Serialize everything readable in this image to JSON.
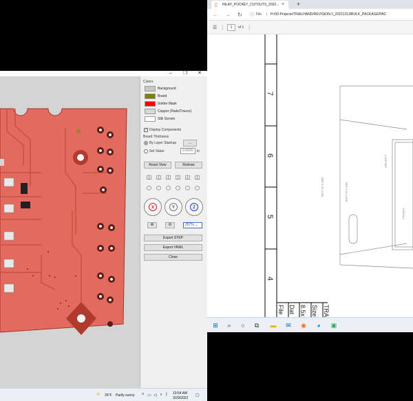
{
  "viewer": {
    "colors_title": "Colors",
    "colors": [
      {
        "label": "Background",
        "color": "#c8c8c8"
      },
      {
        "label": "Board",
        "color": "#808000"
      },
      {
        "label": "Solder Mask",
        "color": "#ff0000"
      },
      {
        "label": "Copper (Pads/Traces)",
        "color": "#d8d8d8"
      },
      {
        "label": "Silk Screen",
        "color": "#ffffff"
      }
    ],
    "display_components_label": "Display Components",
    "display_components_checked": true,
    "board_thickness_title": "Board Thickness",
    "by_layer_stackup_label": "By Layer Stackup",
    "stackup_button_label": "...",
    "set_value_label": "Set Value:",
    "set_value": "0.0626",
    "set_value_unit": "in",
    "reset_view_label": "Reset View",
    "redraw_label": "Redraw",
    "rotation_axes": [
      "X",
      "Y",
      "Z"
    ],
    "zoom_value": "257%",
    "export_step_label": "Export STEP",
    "export_vrml_label": "Export VRML",
    "close_label": "Close",
    "pcb_mask_color": "#e36a5f",
    "pcb_trace_color": "#c9513f"
  },
  "left_taskbar": {
    "weather_temp": "26°F",
    "weather_desc": "Partly sunny",
    "time": "10:54 AM",
    "date": "3/29/2022"
  },
  "browser": {
    "tab_title": "INLAY_POCKET_CUTOUTS_2022...",
    "tab_close": "×",
    "new_tab": "+",
    "address_label": "File",
    "address": "H:/00-Projects/TRAILHAND/REVISION-1_20211213/BULK_PACKAGE/PAC",
    "page_current": "1",
    "page_total": "of 1",
    "ruler_numbers": [
      "7",
      "6",
      "5",
      "4"
    ],
    "title_block_cells": [
      "File",
      "Dat",
      "8.5x",
      "Size",
      "TRA"
    ],
    "dimension_texts": [
      "REF 0.75 ±.005",
      "±.005 REF",
      "REF 0.52 ±.005",
      "±.005 8.0"
    ]
  },
  "right_taskbar": {
    "icons": [
      "windows-icon",
      "search-icon",
      "cortana-icon",
      "task-view-icon",
      "file-explorer-icon",
      "mail-icon",
      "firefox-icon",
      "edge-icon",
      "teams-icon",
      "app-icon"
    ]
  }
}
